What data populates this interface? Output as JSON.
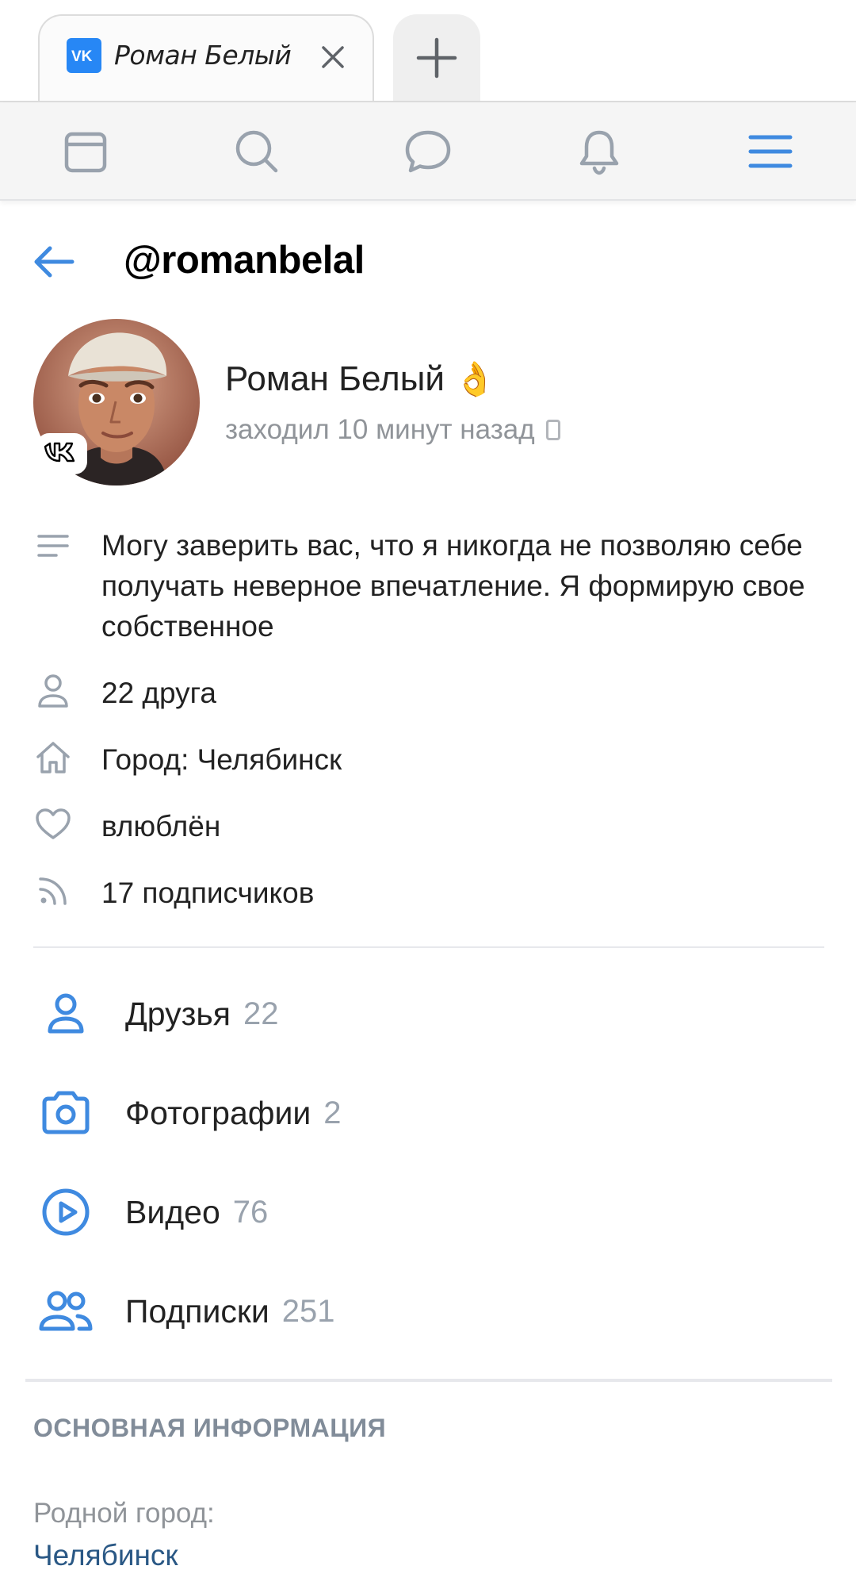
{
  "browser": {
    "tab_title": "Роман Белый",
    "favicon": "vk-logo-icon",
    "accent": "#2787f5"
  },
  "nav": {
    "items": [
      "feed-icon",
      "search-icon",
      "messages-icon",
      "notifications-icon",
      "menu-icon"
    ]
  },
  "header": {
    "username": "@romanbelal"
  },
  "profile": {
    "name": "Роман Белый",
    "name_emoji": "👌",
    "last_seen": "заходил 10 минут назад"
  },
  "info": {
    "status": "Могу заверить вас, что я никогда не позволяю себе получать неверное впечатление. Я формирую свое собственное",
    "friends": "22 друга",
    "city": "Город: Челябинск",
    "relationship": "влюблён",
    "followers": "17 подписчиков"
  },
  "counters": [
    {
      "label": "Друзья",
      "count": "22",
      "icon": "friends-icon"
    },
    {
      "label": "Фотографии",
      "count": "2",
      "icon": "camera-icon"
    },
    {
      "label": "Видео",
      "count": "76",
      "icon": "video-icon"
    },
    {
      "label": "Подписки",
      "count": "251",
      "icon": "subscriptions-icon"
    }
  ],
  "main_info": {
    "title": "ОСНОВНАЯ ИНФОРМАЦИЯ",
    "hometown_label": "Родной город:",
    "hometown_value": "Челябинск"
  },
  "colors": {
    "link": "#2a5885",
    "icon_blue": "#3f8ae0",
    "muted": "#909499"
  }
}
